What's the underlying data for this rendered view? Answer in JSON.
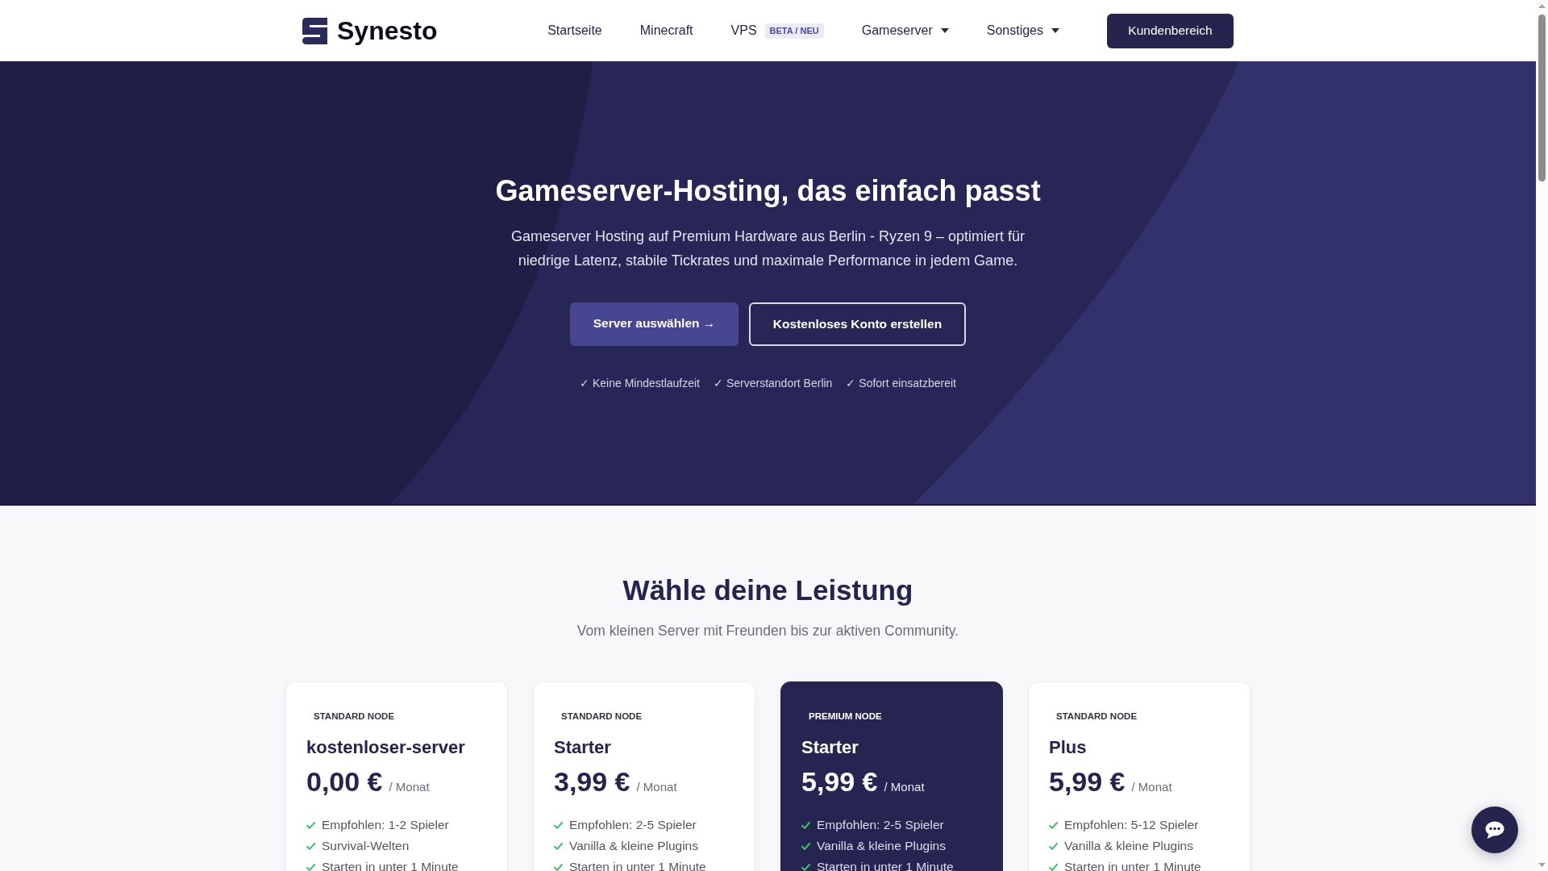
{
  "header": {
    "logo": "Synesto",
    "nav": [
      {
        "label": "Startseite",
        "kind": "link"
      },
      {
        "label": "Minecraft",
        "kind": "link"
      },
      {
        "label": "VPS",
        "kind": "link",
        "badge": "BETA / NEU"
      },
      {
        "label": "Gameserver",
        "kind": "dropdown"
      },
      {
        "label": "Sonstiges",
        "kind": "dropdown"
      }
    ],
    "account_button": "Kundenbereich"
  },
  "hero": {
    "title": "Gameserver-Hosting, das einfach passt",
    "subtitle": "Gameserver Hosting auf Premium Hardware aus Berlin - Ryzen 9 – optimiert für niedrige Latenz, stabile Tickrates und maximale Performance in jedem Game.",
    "buttons": [
      {
        "label": "Server auswählen →",
        "kind": "primary"
      },
      {
        "label": "Kostenloses Konto erstellen",
        "kind": "outline"
      }
    ],
    "highlights": [
      "✓ Keine Mindestlaufzeit",
      "✓ Serverstandort Berlin",
      "✓ Sofort einsatzbereit"
    ]
  },
  "pricing": {
    "title": "Wähle deine Leistung",
    "subtitle": "Vom kleinen Server mit Freunden bis zur aktiven Community.",
    "plans": [
      {
        "node": "STANDARD NODE",
        "name": "kostenloser-server",
        "price": "0,00 €",
        "period": "/ Monat",
        "featured": false,
        "features": [
          "Empfohlen: 1-2 Spieler",
          "Survival-Welten",
          "Starten in unter 1 Minute"
        ]
      },
      {
        "node": "STANDARD NODE",
        "name": "Starter",
        "price": "3,99 €",
        "period": "/ Monat",
        "featured": false,
        "features": [
          "Empfohlen: 2-5 Spieler",
          "Vanilla & kleine Plugins",
          "Starten in unter 1 Minute"
        ]
      },
      {
        "node": "PREMIUM NODE",
        "name": "Starter",
        "price": "5,99 €",
        "period": "/ Monat",
        "featured": true,
        "features": [
          "Empfohlen: 2-5 Spieler",
          "Vanilla & kleine Plugins",
          "Starten in unter 1 Minute"
        ]
      },
      {
        "node": "STANDARD NODE",
        "name": "Plus",
        "price": "5,99 €",
        "period": "/ Monat",
        "featured": false,
        "features": [
          "Empfohlen: 5-12 Spieler",
          "Vanilla & kleine Plugins",
          "Starten in unter 1 Minute"
        ]
      }
    ]
  }
}
